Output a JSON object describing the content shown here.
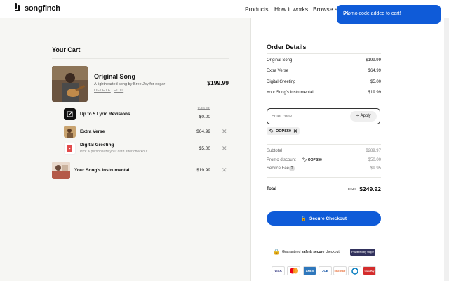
{
  "header": {
    "logo_text": "songfinch",
    "nav": [
      "Products",
      "How it works",
      "Browse art"
    ]
  },
  "toast": {
    "message": "Promo code added to cart!"
  },
  "cart": {
    "title": "Your Cart",
    "main_item": {
      "title": "Original Song",
      "subtitle": "A lighthearted song by Bree Joy for edgar",
      "delete_label": "DELETE",
      "edit_label": "EDIT",
      "price": "$199.99"
    },
    "addons": [
      {
        "title": "Up to 5 Lyric Revisions",
        "old_price": "$49.99",
        "price": "$0.00"
      },
      {
        "title": "Extra Verse",
        "price": "$64.99"
      },
      {
        "title": "Digital Greeting",
        "subtitle": "Pick & personalize your card after checkout",
        "price": "$5.00"
      },
      {
        "title": "Your Song's Instrumental",
        "price": "$19.99"
      }
    ]
  },
  "order": {
    "title": "Order Details",
    "lines": [
      {
        "label": "Original Song",
        "value": "$199.99"
      },
      {
        "label": "Extra Verse",
        "value": "$64.99"
      },
      {
        "label": "Digital Greeting",
        "value": "$5.00"
      },
      {
        "label": "Your Song's Instrumental",
        "value": "$19.99"
      }
    ],
    "promo_placeholder": "Enter code",
    "apply_label": "Apply",
    "applied_code": "OOPS50",
    "subtotal_label": "Subtotal",
    "subtotal_value": "$289.97",
    "discount_label": "Promo discount",
    "discount_code": "OOPS50",
    "discount_value": "$50.00",
    "fee_label": "Service Fee",
    "fee_value": "$9.95",
    "total_label": "Total",
    "currency": "USD",
    "total_value": "$249.92",
    "checkout_label": "Secure Checkout",
    "guarantee_prefix": "Guaranteed ",
    "guarantee_bold": "safe & secure",
    "guarantee_suffix": " checkout",
    "stripe_label": "Powered by stripe"
  },
  "payment_methods": [
    "VISA",
    "mastercard",
    "AMEX",
    "JCB",
    "DISCOVER",
    "Diners",
    "UnionPay"
  ],
  "colors": {
    "accent": "#0f5bd8",
    "background": "#f6f6f3"
  }
}
